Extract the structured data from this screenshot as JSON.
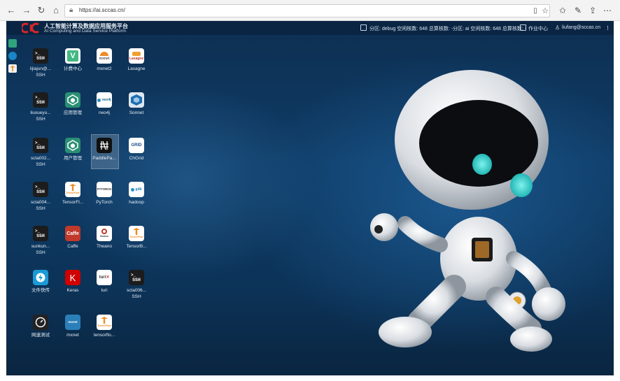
{
  "browser": {
    "url": "https://ai.sccas.cn/",
    "back_icon": "back-arrow-icon",
    "colors": {
      "chrome": "#f3f3f3"
    }
  },
  "header": {
    "brand_cn": "人工智能计算及数据应用服务平台",
    "brand_en": "AI Computing and Data Service Platform",
    "status": "分区: debug 空闲核数: 648 总算核数: -分区: ai 空闲核数: 648 总算核数: -",
    "job_center": "作业中心",
    "user": "liufang@sccas.cn"
  },
  "apps": [
    {
      "label": "lijiajun@...\nSSH",
      "icon": "ssh-icon"
    },
    {
      "label": "计费中心",
      "icon": "vue-icon"
    },
    {
      "label": "mxnet2",
      "icon": "mxnet-icon"
    },
    {
      "label": "Lasagne",
      "icon": "lasagne-icon"
    },
    {
      "label": "liuxueyu...\nSSH",
      "icon": "ssh-icon"
    },
    {
      "label": "应用管理",
      "icon": "cube-icon"
    },
    {
      "label": "neo4j",
      "icon": "neo4j-icon"
    },
    {
      "label": "Sonnet",
      "icon": "sonnet-icon"
    },
    {
      "label": "scta002...\nSSH",
      "icon": "ssh-icon"
    },
    {
      "label": "用户管理",
      "icon": "cube-icon"
    },
    {
      "label": "PaddlePa...",
      "icon": "paddle-icon"
    },
    {
      "label": "ChGrid",
      "icon": "chgrid-icon"
    },
    {
      "label": "scta004...\nSSH",
      "icon": "ssh-icon"
    },
    {
      "label": "TensorFl...",
      "icon": "tensorflow-icon"
    },
    {
      "label": "PyTorch",
      "icon": "pytorch-icon"
    },
    {
      "label": "hadoop",
      "icon": "hadoop-icon"
    },
    {
      "label": "sunkun...\nSSH",
      "icon": "ssh-icon"
    },
    {
      "label": "Caffe",
      "icon": "caffe-icon"
    },
    {
      "label": "Theano",
      "icon": "theano-icon"
    },
    {
      "label": "TensorB...",
      "icon": "tensorboard-icon"
    },
    {
      "label": "文件快传",
      "icon": "lightning-icon"
    },
    {
      "label": "Keras",
      "icon": "keras-icon"
    },
    {
      "label": "turi",
      "icon": "turi-icon"
    },
    {
      "label": "scta006...\nSSH",
      "icon": "ssh-icon"
    },
    {
      "label": "网速测试",
      "icon": "speedometer-icon"
    },
    {
      "label": "mxnet",
      "icon": "mxnet-icon"
    },
    {
      "label": "tensorflo...",
      "icon": "tensorflow-icon"
    }
  ],
  "tile_text": {
    "ssh_prompt": ">_",
    "ssh": "SSH",
    "vue": "V",
    "mxnet2": "mxnet",
    "lasagne": "Lasagne",
    "neo4j": "neo4j",
    "chgrid": "GRID",
    "tensorflow": "TensorFlow",
    "pytorch": "PYTORCH",
    "hadoop": "gdb",
    "caffe": "Caffe",
    "theano": "theano",
    "tensorboard": "TensorFlow",
    "keras": "K",
    "turi": "turi",
    "mxnet": "mxnet"
  }
}
